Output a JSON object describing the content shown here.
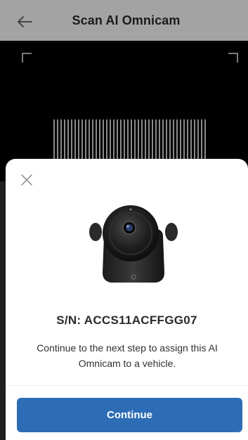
{
  "header": {
    "title": "Scan AI Omnicam",
    "back_icon": "back-arrow-icon",
    "background": "#a3a3a3"
  },
  "viewfinder": {
    "background": "#000000"
  },
  "sheet": {
    "close_icon": "close-icon",
    "serial_label": "S/N: ACCS11ACFFGG07",
    "description": "Continue to the next step to assign this AI Omnicam to a vehicle.",
    "continue_label": "Continue",
    "accent": "#2d6db6"
  }
}
